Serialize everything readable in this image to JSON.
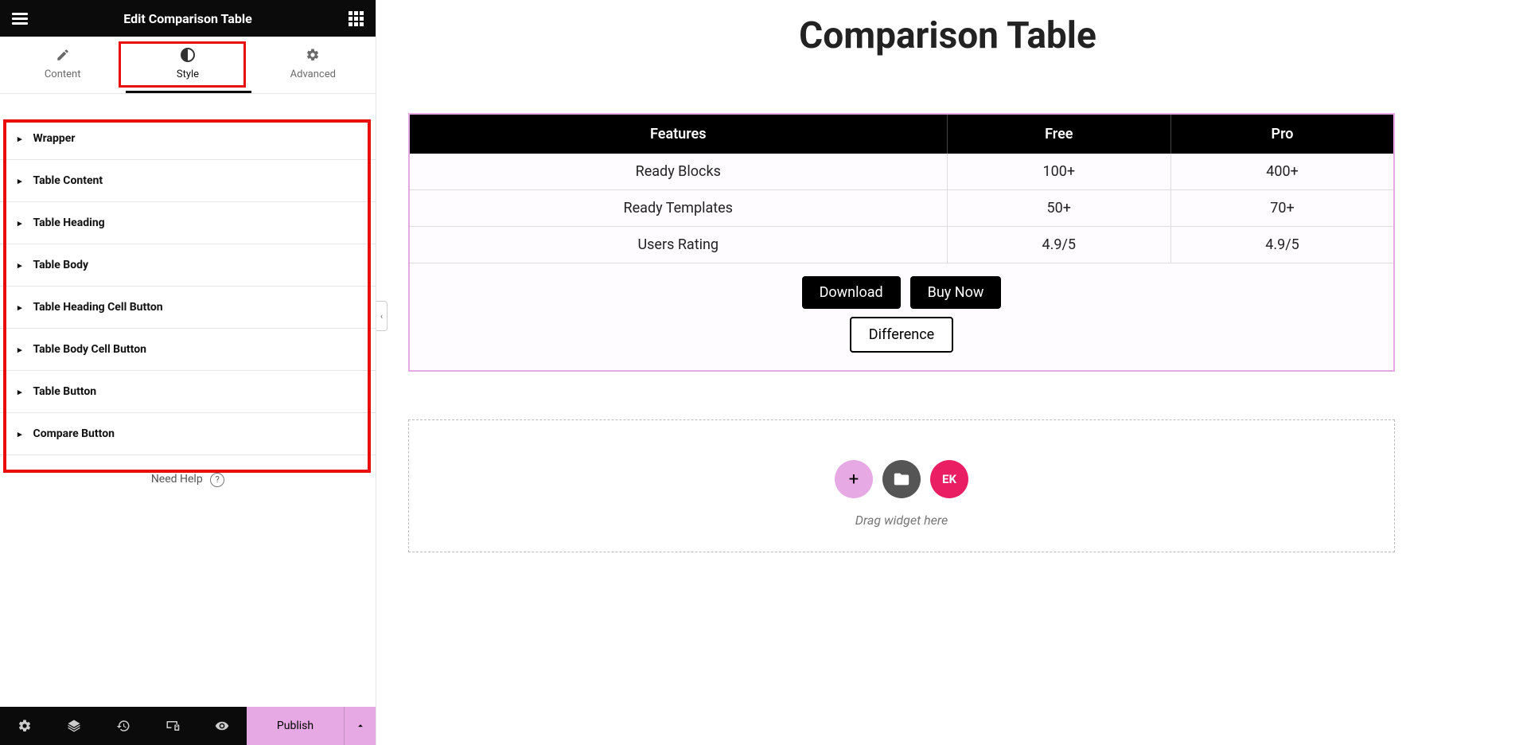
{
  "header": {
    "title": "Edit Comparison Table"
  },
  "tabs": {
    "content": "Content",
    "style": "Style",
    "advanced": "Advanced",
    "active": "style"
  },
  "sections": [
    "Wrapper",
    "Table Content",
    "Table Heading",
    "Table Body",
    "Table Heading Cell Button",
    "Table Body Cell Button",
    "Table Button",
    "Compare Button"
  ],
  "help": {
    "label": "Need Help"
  },
  "footer": {
    "publish": "Publish"
  },
  "preview": {
    "title": "Comparison Table",
    "table": {
      "headers": [
        "Features",
        "Free",
        "Pro"
      ],
      "rows": [
        [
          "Ready Blocks",
          "100+",
          "400+"
        ],
        [
          "Ready Templates",
          "50+",
          "70+"
        ],
        [
          "Users Rating",
          "4.9/5",
          "4.9/5"
        ]
      ]
    },
    "buttons": {
      "download": "Download",
      "buy": "Buy Now",
      "diff": "Difference"
    },
    "drop_hint": "Drag widget here"
  },
  "brand_icon": "EK"
}
